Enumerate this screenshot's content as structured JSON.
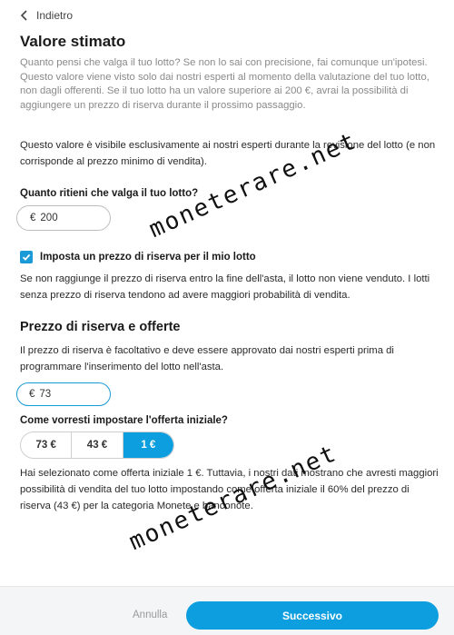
{
  "nav": {
    "back_label": "Indietro"
  },
  "header": {
    "title": "Valore stimato"
  },
  "intro_text": "Quanto pensi che valga il tuo lotto? Se non lo sai con precisione, fai comunque un'ipotesi. Questo valore viene visto solo dai nostri esperti al momento della valutazione del tuo lotto, non dagli offerenti. Se il tuo lotto ha un valore superiore ai 200 €, avrai la possibilità di aggiungere un prezzo di riserva durante il prossimo passaggio.",
  "notice_text": "Questo valore è visibile esclusivamente ai nostri esperti durante la revisione del lotto (e non corrisponde al prezzo minimo di vendita).",
  "estimate": {
    "label": "Quanto ritieni che valga il tuo lotto?",
    "currency": "€",
    "value": "200"
  },
  "reserve_checkbox": {
    "label": "Imposta un prezzo di riserva per il mio lotto",
    "checked": true
  },
  "reserve_note": "Se non raggiunge il prezzo di riserva entro la fine dell'asta, il lotto non viene venduto. I lotti senza prezzo di riserva tendono ad avere maggiori probabilità di vendita.",
  "reserve_section": {
    "title": "Prezzo di riserva e offerte",
    "description": "Il prezzo di riserva è facoltativo e deve essere approvato dai nostri esperti prima di programmare l'inserimento del lotto nell'asta.",
    "currency": "€",
    "value": "73"
  },
  "offer": {
    "label": "Come vorresti impostare l'offerta iniziale?",
    "options": [
      "73 €",
      "43 €",
      "1 €"
    ],
    "selected": "1 €",
    "note": "Hai selezionato come offerta iniziale 1 €. Tuttavia, i nostri dati mostrano che avresti maggiori possibilità di vendita del tuo lotto impostando come offerta iniziale il 60% del prezzo di riserva (43 €) per la categoria Monete e banconote."
  },
  "watermark": "moneterare.net",
  "footer": {
    "cancel_label": "Annulla",
    "next_label": "Successivo"
  },
  "colors": {
    "accent": "#0d9ee0",
    "checkbox": "#1a9ad6",
    "footer_bg": "#f4f5f7"
  }
}
